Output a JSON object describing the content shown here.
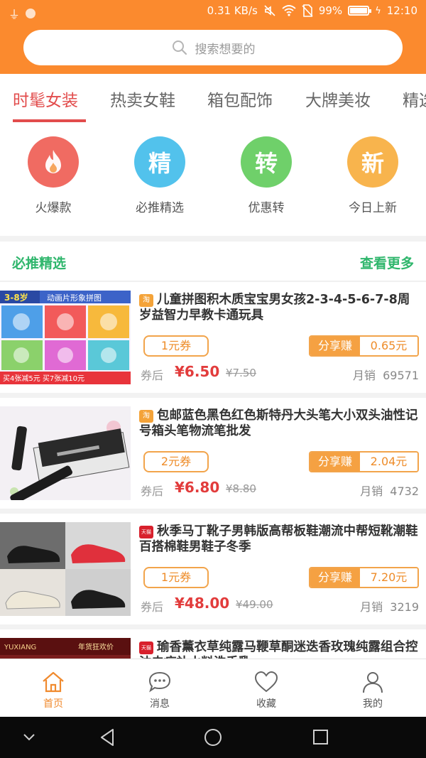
{
  "status_bar": {
    "speed": "0.31 KB/s",
    "battery": "99%",
    "battery_level": 0.99,
    "time": "12:10",
    "icons": [
      "usb-icon",
      "notification-dot-icon",
      "mute-icon",
      "wifi-icon",
      "no-sim-icon",
      "battery-icon",
      "charging-icon"
    ]
  },
  "search": {
    "placeholder": "搜索想要的",
    "icon": "search-icon"
  },
  "tabs": [
    {
      "label": "时髦女装",
      "active": true
    },
    {
      "label": "热卖女鞋"
    },
    {
      "label": "箱包配饰"
    },
    {
      "label": "大牌美妆"
    },
    {
      "label": "精选"
    }
  ],
  "quick_links": [
    {
      "icon": "fire-icon",
      "glyph": "",
      "label": "火爆款",
      "color": "#f06b62"
    },
    {
      "icon": "jing-icon",
      "glyph": "精",
      "label": "必推精选",
      "color": "#52c2ec"
    },
    {
      "icon": "zhuan-icon",
      "glyph": "转",
      "label": "优惠转",
      "color": "#6fd06a"
    },
    {
      "icon": "xin-icon",
      "glyph": "新",
      "label": "今日上新",
      "color": "#f8b44d"
    }
  ],
  "section": {
    "title": "必推精选",
    "more": "查看更多"
  },
  "products": [
    {
      "badge": "淘",
      "platform": "taobao",
      "title": "儿童拼图积木质宝宝男女孩2-3-4-5-6-7-8周岁益智力早教卡通玩具",
      "coupon": "1元券",
      "share_label": "分享赚",
      "share_value": "0.65元",
      "after_label": "券后",
      "price": "¥6.50",
      "original_price": "¥7.50",
      "sales_label": "月销",
      "sales": "69571",
      "image_text": {
        "age": "3-8岁",
        "caption": "动画片形象拼图",
        "promo": "买4张减5元 买7张减10元"
      }
    },
    {
      "badge": "淘",
      "platform": "taobao",
      "title": "包邮蓝色黑色红色斯特丹大头笔大小双头油性记号箱头笔物流笔批发",
      "coupon": "2元券",
      "share_label": "分享赚",
      "share_value": "2.04元",
      "after_label": "券后",
      "price": "¥6.80",
      "original_price": "¥8.80",
      "sales_label": "月销",
      "sales": "4732"
    },
    {
      "badge": "天猫",
      "platform": "tmall",
      "title": "秋季马丁靴子男韩版高帮板鞋潮流中帮短靴潮鞋百搭棉鞋男鞋子冬季",
      "coupon": "1元券",
      "share_label": "分享赚",
      "share_value": "7.20元",
      "after_label": "券后",
      "price": "¥48.00",
      "original_price": "¥49.00",
      "sales_label": "月销",
      "sales": "3219"
    },
    {
      "badge": "天猫",
      "platform": "tmall",
      "title": "瑜香薰衣草纯露马鞭草酮迷迭香玫瑰纯露组合控油去痘补水料洗手乳",
      "image_text": {
        "brand": "YUXIANG",
        "promo": "年货狂欢价"
      }
    }
  ],
  "bottom_nav": [
    {
      "icon": "home-icon",
      "label": "首页",
      "active": true
    },
    {
      "icon": "message-icon",
      "label": "消息"
    },
    {
      "icon": "heart-icon",
      "label": "收藏"
    },
    {
      "icon": "user-icon",
      "label": "我的"
    }
  ],
  "system_nav": [
    "chevron-down-icon",
    "back-icon",
    "home-circle-icon",
    "recents-icon"
  ],
  "colors": {
    "brand_orange": "#fb8a2e",
    "tab_active": "#e24c4c",
    "section_green": "#2fb66c",
    "price_red": "#e23c3c",
    "coupon_orange": "#ee8c29"
  }
}
